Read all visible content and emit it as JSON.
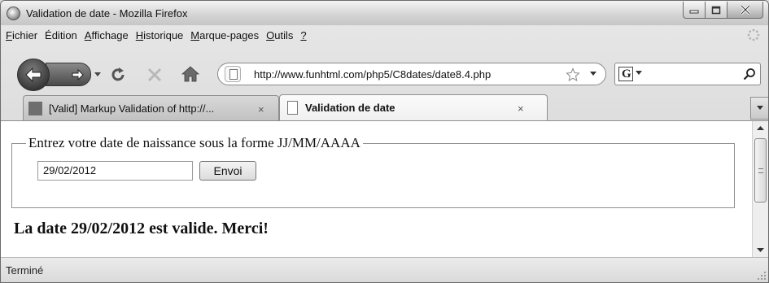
{
  "window": {
    "title": "Validation de date - Mozilla Firefox"
  },
  "menubar": {
    "items": [
      {
        "first": "F",
        "rest": "ichier"
      },
      {
        "first": "",
        "rest": "Édition"
      },
      {
        "first": "A",
        "rest": "ffichage"
      },
      {
        "first": "H",
        "rest": "istorique"
      },
      {
        "first": "M",
        "rest": "arque-pages"
      },
      {
        "first": "O",
        "rest": "utils"
      },
      {
        "first": "?",
        "rest": ""
      }
    ]
  },
  "navbar": {
    "url": "http://www.funhtml.com/php5/C8dates/date8.4.php",
    "search_value": "",
    "search_engine_letter": "G"
  },
  "tabs": [
    {
      "title": "[Valid] Markup Validation of http://...",
      "close": "×",
      "active": false
    },
    {
      "title": "Validation de date",
      "close": "×",
      "active": true
    }
  ],
  "content": {
    "legend": "Entrez votre date de naissance sous la forme JJ/MM/AAAA",
    "date_value": "29/02/2012",
    "submit_label": "Envoi",
    "result": "La date 29/02/2012 est valide. Merci!"
  },
  "statusbar": {
    "text": "Terminé"
  },
  "colors": {
    "window_bg": "#d9d9d9",
    "content_bg": "#ffffff",
    "button_dark": "#3a3a3a"
  }
}
